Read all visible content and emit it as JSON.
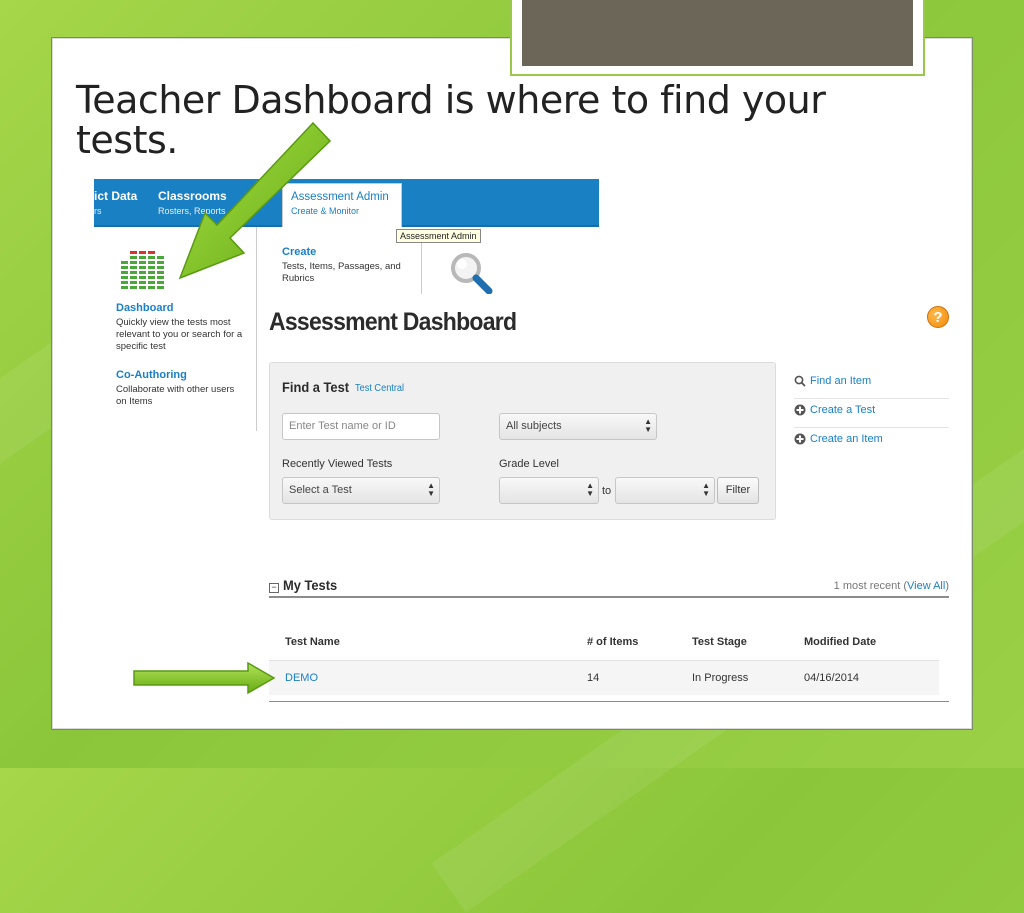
{
  "slide": {
    "title": "Teacher Dashboard is where to find your tests."
  },
  "nav": {
    "items": [
      {
        "title": "ict Data",
        "subtitle": "rs"
      },
      {
        "title": "Classrooms",
        "subtitle": "Rosters, Reports"
      },
      {
        "title": "Assessment Admin",
        "subtitle": "Create & Monitor"
      }
    ],
    "tooltip": "Assessment Admin"
  },
  "menu": {
    "dashboard": {
      "label": "Dashboard",
      "desc": "Quickly view the tests most relevant to you or search for a specific test"
    },
    "coauthoring": {
      "label": "Co-Authoring",
      "desc": "Collaborate with other users on Items"
    },
    "create": {
      "label": "Create",
      "desc": "Tests, Items, Passages, and Rubrics"
    }
  },
  "dashboard": {
    "title": "Assessment Dashboard",
    "help": "?",
    "find": {
      "title": "Find a Test",
      "link": "Test Central",
      "search_placeholder": "Enter Test name or ID",
      "subject_value": "All subjects",
      "recent_label": "Recently Viewed Tests",
      "recent_value": "Select a Test",
      "grade_label": "Grade Level",
      "to_label": "to",
      "filter_label": "Filter"
    },
    "side_links": [
      "Find an Item",
      "Create a Test",
      "Create an Item"
    ],
    "my_tests": {
      "title": "My Tests",
      "collapse": "−",
      "recent_text": "1 most recent (",
      "view_all": "View All",
      "recent_close": ")",
      "columns": [
        "Test Name",
        "# of Items",
        "Test Stage",
        "Modified Date"
      ],
      "rows": [
        {
          "name": "DEMO",
          "items": "14",
          "stage": "In Progress",
          "modified": "04/16/2014"
        }
      ]
    }
  },
  "colors": {
    "background_green": "#9ad046",
    "arrow_green": "#7fc21a",
    "nav_blue": "#1a80c4",
    "help_orange": "#f39a1e"
  }
}
